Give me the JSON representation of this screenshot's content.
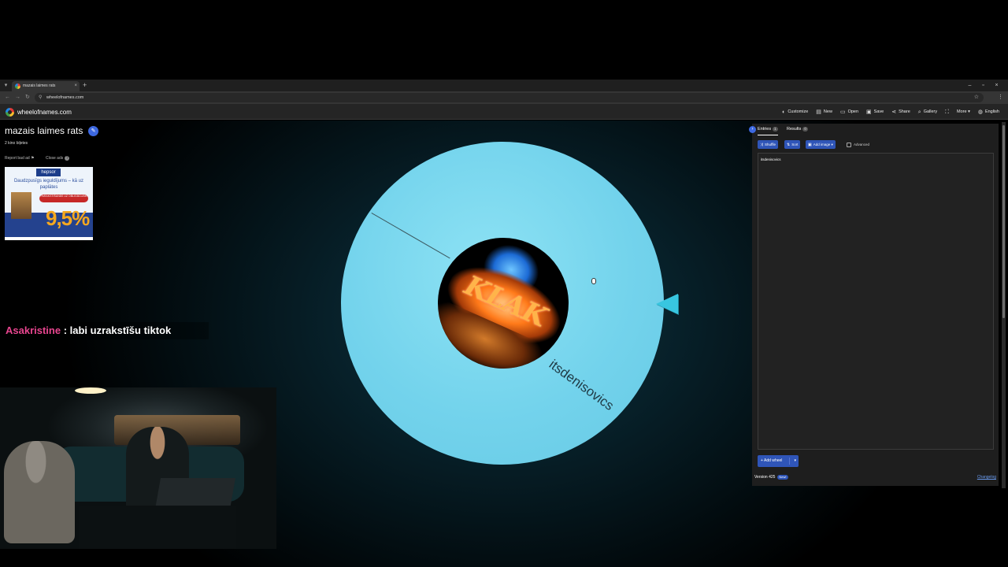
{
  "browser": {
    "tab_title": "mazais laimes rats",
    "url": "wheelofnames.com",
    "tab_close": "×",
    "new_tab": "+",
    "window_controls": [
      "–",
      "▫",
      "×"
    ]
  },
  "site": {
    "name": "wheelofnames.com",
    "menu": [
      {
        "icon": "palette-icon",
        "glyph": "◐",
        "label": "Customize"
      },
      {
        "icon": "new-file-icon",
        "glyph": "▤",
        "label": "New"
      },
      {
        "icon": "folder-icon",
        "glyph": "▭",
        "label": "Open"
      },
      {
        "icon": "save-icon",
        "glyph": "▣",
        "label": "Save"
      },
      {
        "icon": "share-icon",
        "glyph": "⋖",
        "label": "Share"
      },
      {
        "icon": "search-icon",
        "glyph": "⌕",
        "label": "Gallery"
      },
      {
        "icon": "fullscreen-icon",
        "glyph": "⛶",
        "label": ""
      },
      {
        "icon": "more-icon",
        "glyph": "",
        "label": "More ▾"
      },
      {
        "icon": "globe-icon",
        "glyph": "◍",
        "label": "English"
      }
    ]
  },
  "left": {
    "wheel_title": "mazais laimes rats",
    "subtitle": "2 kino biļetes",
    "report_ad": "Report bad ad",
    "close_ads": "Close ads"
  },
  "ad": {
    "brand": "hepsor",
    "headline": "Daudzpusīgs ieguldījums – kā uz paplātes",
    "pill": "PARAKSTIŠANĀS UZ OBLIGĀCIJĀM",
    "rate": "9,5%"
  },
  "chat": {
    "user": "Asakristine",
    "message": " : labi uzrakstīšu tiktok"
  },
  "wheel": {
    "center_text": "KLAK",
    "segments": [
      "itsdenisovics"
    ],
    "color": "#73d3ec"
  },
  "panel": {
    "tabs": [
      {
        "label": "Entries",
        "count": "1"
      },
      {
        "label": "Results",
        "count": "0"
      }
    ],
    "buttons": {
      "shuffle": "Shuffle",
      "sort": "Sort",
      "add_image": "Add image"
    },
    "advanced": "Advanced",
    "entries": [
      "itsdenisovics"
    ],
    "add_wheel": "Add wheel",
    "version": "Version 425",
    "new_badge": "New!",
    "changelog": "Changelog"
  }
}
